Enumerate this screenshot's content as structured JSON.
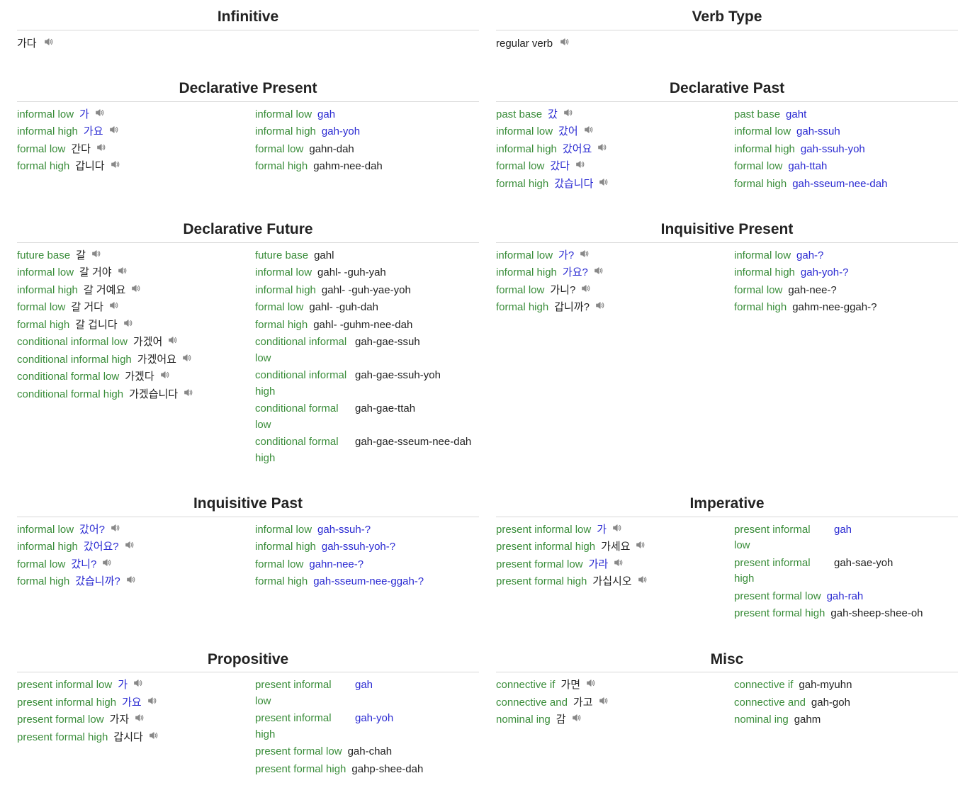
{
  "panels": [
    {
      "id": "infinitive",
      "title": "Infinitive",
      "type": "single",
      "value": "가다",
      "link": false,
      "audio": true
    },
    {
      "id": "verb-type",
      "title": "Verb Type",
      "type": "single",
      "value": "regular verb",
      "link": false,
      "audio": true
    },
    {
      "id": "declarative-present",
      "title": "Declarative Present",
      "type": "pair",
      "left": [
        {
          "key": "informal low",
          "val": "가",
          "link": true,
          "audio": true
        },
        {
          "key": "informal high",
          "val": "가요",
          "link": true,
          "audio": true
        },
        {
          "key": "formal low",
          "val": "간다",
          "link": false,
          "audio": true
        },
        {
          "key": "formal high",
          "val": "갑니다",
          "link": false,
          "audio": true
        }
      ],
      "right": [
        {
          "key": "informal low",
          "val": "gah",
          "link": true
        },
        {
          "key": "informal high",
          "val": "gah-yoh",
          "link": true
        },
        {
          "key": "formal low",
          "val": "gahn-dah",
          "link": false
        },
        {
          "key": "formal high",
          "val": "gahm-nee-dah",
          "link": false
        }
      ]
    },
    {
      "id": "declarative-past",
      "title": "Declarative Past",
      "type": "pair",
      "left": [
        {
          "key": "past base",
          "val": "갔",
          "link": true,
          "audio": true
        },
        {
          "key": "informal low",
          "val": "갔어",
          "link": true,
          "audio": true
        },
        {
          "key": "informal high",
          "val": "갔어요",
          "link": true,
          "audio": true
        },
        {
          "key": "formal low",
          "val": "갔다",
          "link": true,
          "audio": true
        },
        {
          "key": "formal high",
          "val": "갔습니다",
          "link": true,
          "audio": true
        }
      ],
      "right": [
        {
          "key": "past base",
          "val": "gaht",
          "link": true
        },
        {
          "key": "informal low",
          "val": "gah-ssuh",
          "link": true
        },
        {
          "key": "informal high",
          "val": "gah-ssuh-yoh",
          "link": true
        },
        {
          "key": "formal low",
          "val": "gah-ttah",
          "link": true
        },
        {
          "key": "formal high",
          "val": "gah-sseum-nee-dah",
          "link": true
        }
      ]
    },
    {
      "id": "declarative-future",
      "title": "Declarative Future",
      "type": "pair",
      "left": [
        {
          "key": "future base",
          "val": "갈",
          "link": false,
          "audio": true
        },
        {
          "key": "informal low",
          "val": "갈 거야",
          "link": false,
          "audio": true
        },
        {
          "key": "informal high",
          "val": "갈 거예요",
          "link": false,
          "audio": true
        },
        {
          "key": "formal low",
          "val": "갈 거다",
          "link": false,
          "audio": true
        },
        {
          "key": "formal high",
          "val": "갈 겁니다",
          "link": false,
          "audio": true
        },
        {
          "key": "conditional informal low",
          "val": "가겠어",
          "link": false,
          "audio": true
        },
        {
          "key": "conditional informal high",
          "val": "가겠어요",
          "link": false,
          "audio": true
        },
        {
          "key": "conditional formal low",
          "val": "가겠다",
          "link": false,
          "audio": true
        },
        {
          "key": "conditional formal high",
          "val": "가겠습니다",
          "link": false,
          "audio": true
        }
      ],
      "right": [
        {
          "key": "future base",
          "val": "gahl",
          "link": false
        },
        {
          "key": "informal low",
          "val": "gahl- -guh-yah",
          "link": false
        },
        {
          "key": "informal high",
          "val": "gahl- -guh-yae-yoh",
          "link": false
        },
        {
          "key": "formal low",
          "val": "gahl- -guh-dah",
          "link": false
        },
        {
          "key": "formal high",
          "val": "gahl- -guhm-nee-dah",
          "link": false
        },
        {
          "key": "conditional informal low",
          "val": "gah-gae-ssuh",
          "link": false
        },
        {
          "key": "conditional informal high",
          "val": "gah-gae-ssuh-yoh",
          "link": false
        },
        {
          "key": "conditional formal low",
          "val": "gah-gae-ttah",
          "link": false
        },
        {
          "key": "conditional formal high",
          "val": "gah-gae-sseum-nee-dah",
          "link": false
        }
      ]
    },
    {
      "id": "inquisitive-present",
      "title": "Inquisitive Present",
      "type": "pair",
      "left": [
        {
          "key": "informal low",
          "val": "가?",
          "link": true,
          "audio": true
        },
        {
          "key": "informal high",
          "val": "가요?",
          "link": true,
          "audio": true
        },
        {
          "key": "formal low",
          "val": "가니?",
          "link": false,
          "audio": true
        },
        {
          "key": "formal high",
          "val": "갑니까?",
          "link": false,
          "audio": true
        }
      ],
      "right": [
        {
          "key": "informal low",
          "val": "gah-?",
          "link": true
        },
        {
          "key": "informal high",
          "val": "gah-yoh-?",
          "link": true
        },
        {
          "key": "formal low",
          "val": "gah-nee-?",
          "link": false
        },
        {
          "key": "formal high",
          "val": "gahm-nee-ggah-?",
          "link": false
        }
      ]
    },
    {
      "id": "inquisitive-past",
      "title": "Inquisitive Past",
      "type": "pair",
      "left": [
        {
          "key": "informal low",
          "val": "갔어?",
          "link": true,
          "audio": true
        },
        {
          "key": "informal high",
          "val": "갔어요?",
          "link": true,
          "audio": true
        },
        {
          "key": "formal low",
          "val": "갔니?",
          "link": true,
          "audio": true
        },
        {
          "key": "formal high",
          "val": "갔습니까?",
          "link": true,
          "audio": true
        }
      ],
      "right": [
        {
          "key": "informal low",
          "val": "gah-ssuh-?",
          "link": true
        },
        {
          "key": "informal high",
          "val": "gah-ssuh-yoh-?",
          "link": true
        },
        {
          "key": "formal low",
          "val": "gahn-nee-?",
          "link": true
        },
        {
          "key": "formal high",
          "val": "gah-sseum-nee-ggah-?",
          "link": true
        }
      ]
    },
    {
      "id": "imperative",
      "title": "Imperative",
      "type": "pair",
      "left": [
        {
          "key": "present informal low",
          "val": "가",
          "link": true,
          "audio": true
        },
        {
          "key": "present informal high",
          "val": "가세요",
          "link": false,
          "audio": true
        },
        {
          "key": "present formal low",
          "val": "가라",
          "link": true,
          "audio": true
        },
        {
          "key": "present formal high",
          "val": "가십시오",
          "link": false,
          "audio": true
        }
      ],
      "right": [
        {
          "key": "present informal low",
          "val": "gah",
          "link": true
        },
        {
          "key": "present informal high",
          "val": "gah-sae-yoh",
          "link": false
        },
        {
          "key": "present formal low",
          "val": "gah-rah",
          "link": true
        },
        {
          "key": "present formal high",
          "val": "gah-sheep-shee-oh",
          "link": false
        }
      ]
    },
    {
      "id": "propositive",
      "title": "Propositive",
      "type": "pair",
      "left": [
        {
          "key": "present informal low",
          "val": "가",
          "link": true,
          "audio": true
        },
        {
          "key": "present informal high",
          "val": "가요",
          "link": true,
          "audio": true
        },
        {
          "key": "present formal low",
          "val": "가자",
          "link": false,
          "audio": true
        },
        {
          "key": "present formal high",
          "val": "갑시다",
          "link": false,
          "audio": true
        }
      ],
      "right": [
        {
          "key": "present informal low",
          "val": "gah",
          "link": true
        },
        {
          "key": "present informal high",
          "val": "gah-yoh",
          "link": true
        },
        {
          "key": "present formal low",
          "val": "gah-chah",
          "link": false
        },
        {
          "key": "present formal high",
          "val": "gahp-shee-dah",
          "link": false
        }
      ]
    },
    {
      "id": "misc",
      "title": "Misc",
      "type": "pair",
      "left": [
        {
          "key": "connective if",
          "val": "가면",
          "link": false,
          "audio": true
        },
        {
          "key": "connective and",
          "val": "가고",
          "link": false,
          "audio": true
        },
        {
          "key": "nominal ing",
          "val": "감",
          "link": false,
          "audio": true
        }
      ],
      "right": [
        {
          "key": "connective if",
          "val": "gah-myuhn",
          "link": false
        },
        {
          "key": "connective and",
          "val": "gah-goh",
          "link": false
        },
        {
          "key": "nominal ing",
          "val": "gahm",
          "link": false
        }
      ]
    }
  ]
}
